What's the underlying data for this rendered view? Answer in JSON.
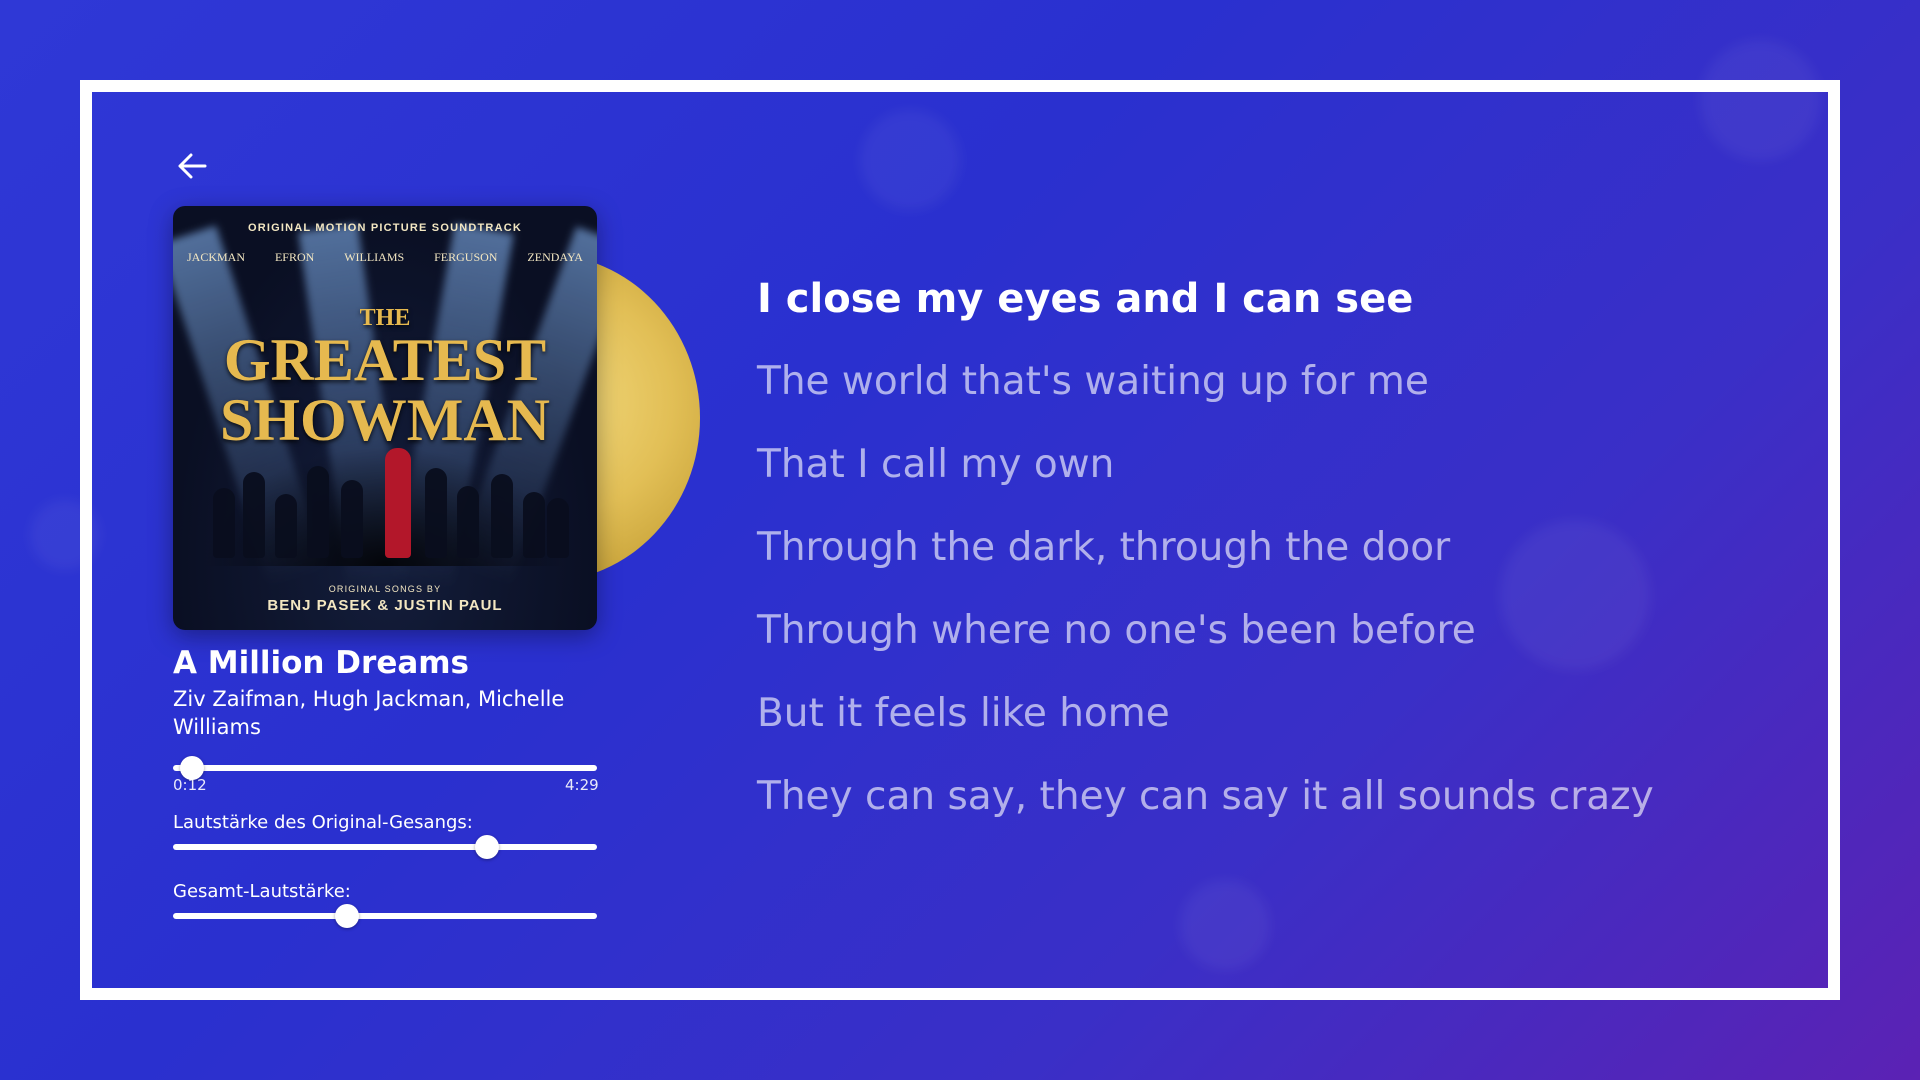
{
  "navigation": {
    "back_icon": "arrow-left-icon"
  },
  "album": {
    "cover_top_text": "ORIGINAL MOTION PICTURE SOUNDTRACK",
    "cover_cast": [
      "JACKMAN",
      "EFRON",
      "WILLIAMS",
      "FERGUSON",
      "ZENDAYA"
    ],
    "cover_title_small": "THE",
    "cover_title_line1": "GREATEST",
    "cover_title_line2": "SHOWMAN",
    "cover_songs_by": "ORIGINAL SONGS BY",
    "cover_writers": "BENJ PASEK & JUSTIN PAUL",
    "disc_color": "#e2bf56"
  },
  "track": {
    "title": "A Million Dreams",
    "artist": "Ziv Zaifman, Hugh Jackman, Michelle Williams"
  },
  "playback": {
    "elapsed": "0:12",
    "duration": "4:29",
    "progress_fraction": 0.045
  },
  "volume": {
    "vocals_label": "Lautstärke des Original-Gesangs:",
    "vocals_level": 0.74,
    "total_label": "Gesamt-Lautstärke:",
    "total_level": 0.41
  },
  "lyrics": {
    "lines": [
      "I close my eyes and I can see",
      "The world that's waiting up for me",
      "That I call my own",
      "Through the dark, through the door",
      "Through where no one's been before",
      "But it feels like home",
      "They can say, they can say it all sounds crazy"
    ],
    "current_index": 0
  },
  "colors": {
    "background_start": "#2f38d6",
    "background_end": "#5b22b4",
    "frame": "#ffffff",
    "text": "#ffffff"
  }
}
